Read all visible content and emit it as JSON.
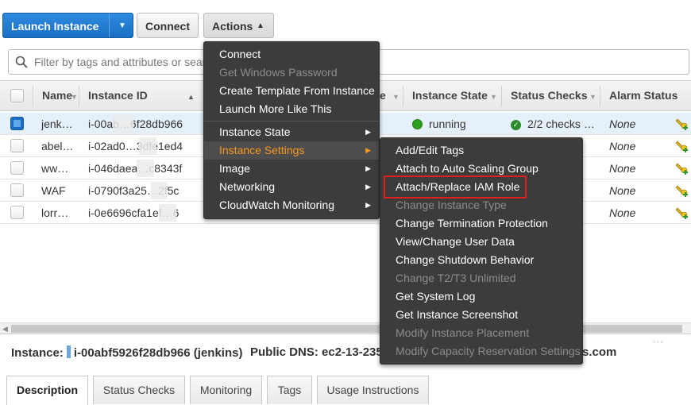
{
  "toolbar": {
    "launch_label": "Launch Instance",
    "connect_label": "Connect",
    "actions_label": "Actions"
  },
  "search": {
    "placeholder": "Filter by tags and attributes or search"
  },
  "columns": {
    "name": "Name",
    "instance_id": "Instance ID",
    "type_tail": "e",
    "instance_state": "Instance State",
    "status_checks": "Status Checks",
    "alarm_status": "Alarm Status"
  },
  "rows": [
    {
      "name": "jenk…",
      "id": "i-00ab…6f28db966",
      "state": "running",
      "checks": "2/2 checks …",
      "alarm": "None",
      "selected": true
    },
    {
      "name": "abel…",
      "id": "i-02ad0…3dfe1ed4",
      "alarm": "None"
    },
    {
      "name": "ww…",
      "id": "i-046daea…c8343f",
      "alarm": "None"
    },
    {
      "name": "WAF",
      "id": "i-0790f3a25…2f5c",
      "alarm": "None"
    },
    {
      "name": "lorr…",
      "id": "i-0e6696cfa1ef…6",
      "alarm": "None"
    }
  ],
  "details": {
    "instance_label": "Instance:",
    "instance_value": "i-00abf5926f28db966 (jenkins)",
    "dns_label": "Public DNS:",
    "dns_value": "ec2-13-235-",
    "dns_tail": "s.com"
  },
  "tabs": [
    "Description",
    "Status Checks",
    "Monitoring",
    "Tags",
    "Usage Instructions"
  ],
  "actions_menu": [
    {
      "label": "Connect",
      "disabled": false
    },
    {
      "label": "Get Windows Password",
      "disabled": true
    },
    {
      "label": "Create Template From Instance",
      "disabled": false
    },
    {
      "label": "Launch More Like This",
      "disabled": false
    },
    {
      "label": "Instance State",
      "submenu": true
    },
    {
      "label": "Instance Settings",
      "submenu": true,
      "highlighted": true
    },
    {
      "label": "Image",
      "submenu": true
    },
    {
      "label": "Networking",
      "submenu": true
    },
    {
      "label": "CloudWatch Monitoring",
      "submenu": true
    }
  ],
  "settings_submenu": [
    {
      "label": "Add/Edit Tags",
      "disabled": false
    },
    {
      "label": "Attach to Auto Scaling Group",
      "disabled": false
    },
    {
      "label": "Attach/Replace IAM Role",
      "disabled": false,
      "outlined": true
    },
    {
      "label": "Change Instance Type",
      "disabled": true
    },
    {
      "label": "Change Termination Protection",
      "disabled": false
    },
    {
      "label": "View/Change User Data",
      "disabled": false
    },
    {
      "label": "Change Shutdown Behavior",
      "disabled": false
    },
    {
      "label": "Change T2/T3 Unlimited",
      "disabled": true
    },
    {
      "label": "Get System Log",
      "disabled": false
    },
    {
      "label": "Get Instance Screenshot",
      "disabled": false
    },
    {
      "label": "Modify Instance Placement",
      "disabled": true
    },
    {
      "label": "Modify Capacity Reservation Settings",
      "disabled": true
    }
  ],
  "colors": {
    "primary": "#1a6fc4",
    "menu_bg": "#3c3c3c",
    "menu_highlight": "#f7981d",
    "outline": "#e0201e",
    "running": "#2ea01f"
  }
}
